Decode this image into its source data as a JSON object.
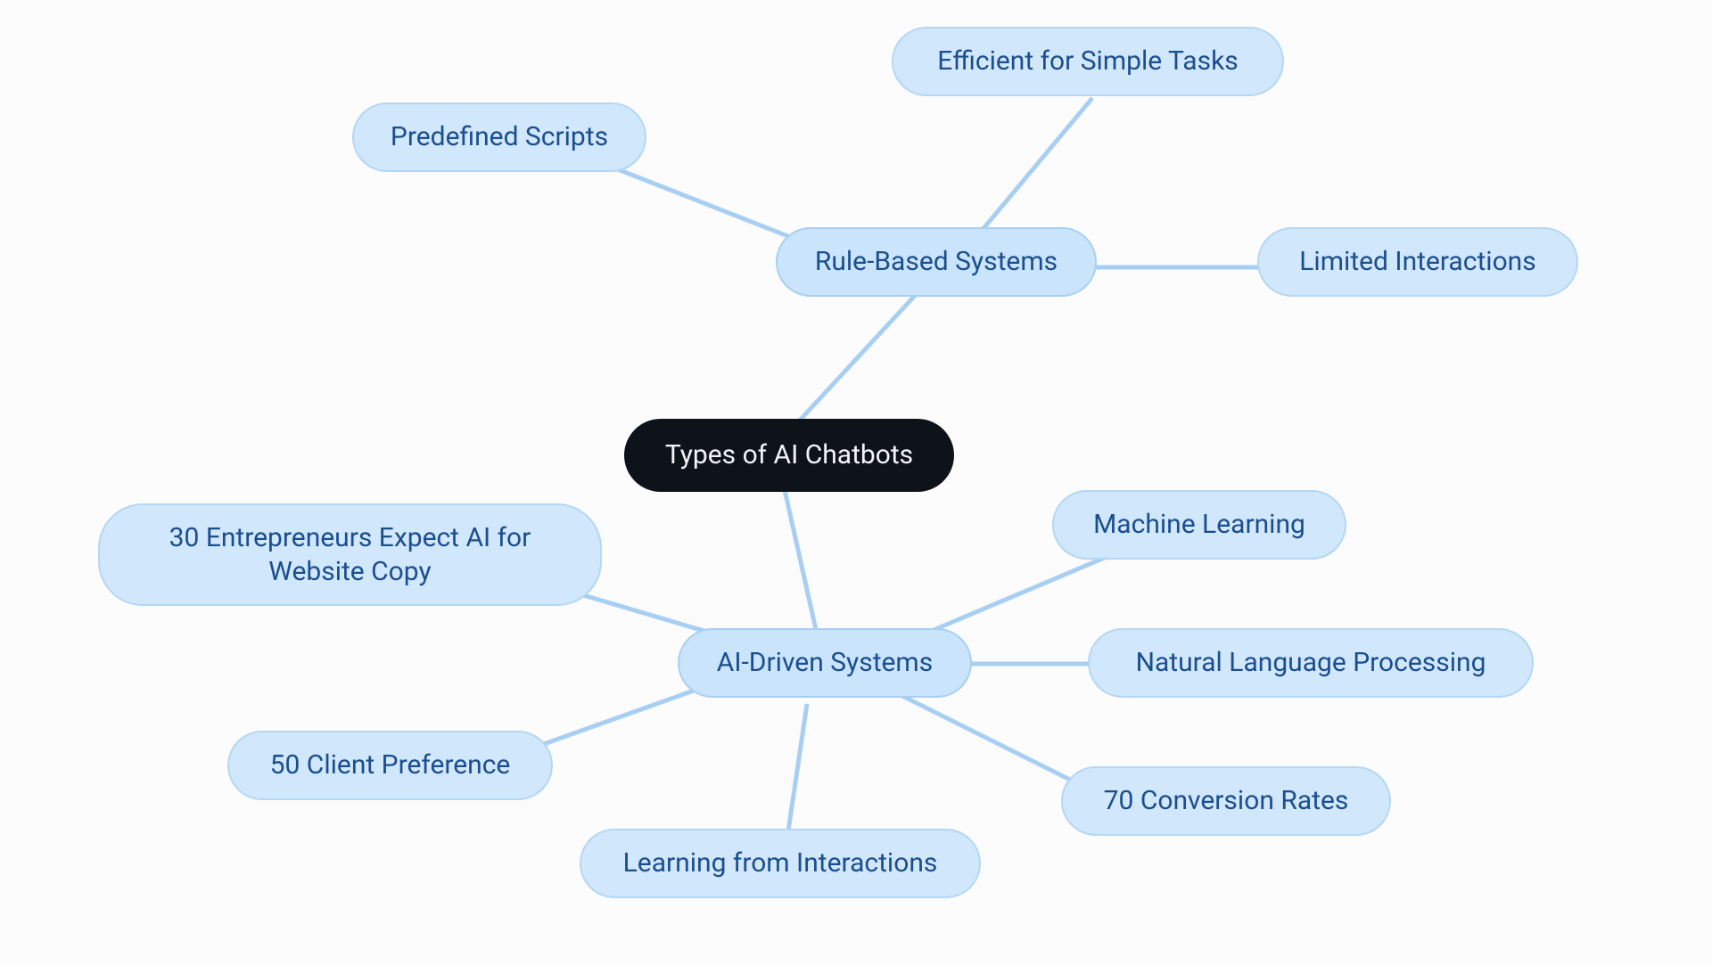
{
  "root": {
    "label": "Types of AI Chatbots"
  },
  "branches": {
    "ruleBased": {
      "label": "Rule-Based Systems"
    },
    "aiDriven": {
      "label": "AI-Driven Systems"
    }
  },
  "leaves": {
    "predefinedScripts": {
      "label": "Predefined Scripts"
    },
    "efficientSimple": {
      "label": "Efficient for Simple Tasks"
    },
    "limitedInteractions": {
      "label": "Limited Interactions"
    },
    "entrepreneurs30": {
      "label": "30 Entrepreneurs Expect AI for\nWebsite Copy"
    },
    "clientPref50": {
      "label": "50 Client Preference"
    },
    "learningFrom": {
      "label": "Learning from Interactions"
    },
    "conversion70": {
      "label": "70 Conversion Rates"
    },
    "nlp": {
      "label": "Natural Language Processing"
    },
    "machineLearning": {
      "label": "Machine Learning"
    }
  },
  "colors": {
    "rootBg": "#0e1219",
    "rootText": "#f2f4f7",
    "branchBg": "#cae4fb",
    "leafBg": "#d1e7fb",
    "nodeText": "#1b4e8f",
    "edge": "#a8cff2"
  }
}
